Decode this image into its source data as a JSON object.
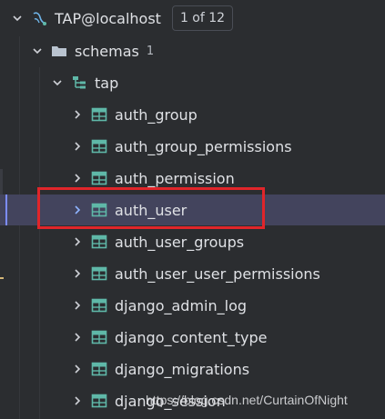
{
  "connection": {
    "label": "TAP@localhost",
    "page_badge": "1 of 12",
    "icon": "database-connection-icon"
  },
  "schemas": {
    "label": "schemas",
    "count": "1",
    "icon": "folder-icon"
  },
  "schema": {
    "label": "tap",
    "icon": "schema-icon"
  },
  "tables": [
    {
      "label": "auth_group",
      "selected": false
    },
    {
      "label": "auth_group_permissions",
      "selected": false
    },
    {
      "label": "auth_permission",
      "selected": false
    },
    {
      "label": "auth_user",
      "selected": true
    },
    {
      "label": "auth_user_groups",
      "selected": false
    },
    {
      "label": "auth_user_user_permissions",
      "selected": false
    },
    {
      "label": "django_admin_log",
      "selected": false
    },
    {
      "label": "django_content_type",
      "selected": false
    },
    {
      "label": "django_migrations",
      "selected": false
    },
    {
      "label": "django_session",
      "selected": false
    }
  ],
  "watermark": "https://blog.csdn.net/CurtainOfNight",
  "colors": {
    "background": "#2b2d30",
    "selected_row": "#43445d",
    "table_icon": "#5fb8a8",
    "folder_icon": "#a9b7c6",
    "highlight_box": "#e0252a"
  }
}
